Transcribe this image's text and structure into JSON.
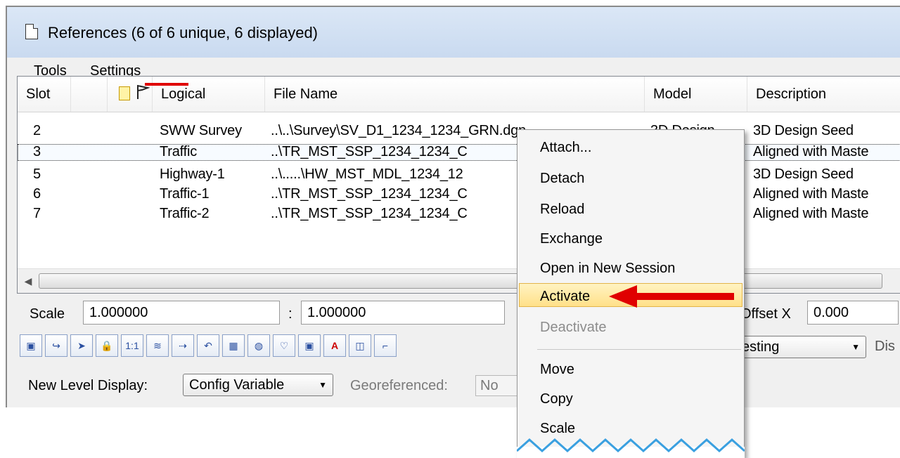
{
  "window": {
    "title": "References (6 of 6 unique, 6 displayed)"
  },
  "menubar": {
    "items": [
      {
        "label": "Tools"
      },
      {
        "label": "Settings"
      }
    ]
  },
  "columns": {
    "slot": "Slot",
    "logical": "Logical",
    "file_name": "File Name",
    "model": "Model",
    "description": "Description"
  },
  "rows": [
    {
      "slot": "2",
      "logical": "SWW Survey",
      "file": "..\\..\\Survey\\SV_D1_1234_1234_GRN.dgn",
      "model": "3D Design",
      "description": "3D Design Seed"
    },
    {
      "slot": "3",
      "logical": "Traffic",
      "file": "..\\TR_MST_SSP_1234_1234_C",
      "model": "",
      "description": "Aligned with Maste"
    },
    {
      "slot": "5",
      "logical": "Highway-1",
      "file": "..\\.....\\HW_MST_MDL_1234_12",
      "model": "",
      "description": "3D Design Seed"
    },
    {
      "slot": "6",
      "logical": "Traffic-1",
      "file": "..\\TR_MST_SSP_1234_1234_C",
      "model": "",
      "description": "Aligned with Maste"
    },
    {
      "slot": "7",
      "logical": "Traffic-2",
      "file": "..\\TR_MST_SSP_1234_1234_C",
      "model": "",
      "description": "Aligned with Maste"
    }
  ],
  "selected_row_index": 1,
  "scale": {
    "label": "Scale",
    "value1": "1.000000",
    "sep": ":",
    "value2": "1.000000"
  },
  "offset": {
    "label": "Offset X",
    "value": "0.000"
  },
  "nesting": {
    "value": "esting"
  },
  "display_label": "Dis",
  "new_level_display": {
    "label": "New Level Display:",
    "value": "Config Variable"
  },
  "georeferenced": {
    "label": "Georeferenced:",
    "value": "No"
  },
  "toolbar_buttons": [
    {
      "icon": "attach-icon",
      "text": "▣"
    },
    {
      "icon": "hook-icon",
      "text": "↪"
    },
    {
      "icon": "pointer-icon",
      "text": "➤"
    },
    {
      "icon": "lock-icon",
      "text": "🔒"
    },
    {
      "icon": "scale-1-1-icon",
      "text": "1:1"
    },
    {
      "icon": "level-icon",
      "text": "≋"
    },
    {
      "icon": "move-icon",
      "text": "⇢"
    },
    {
      "icon": "rotate-icon",
      "text": "↶"
    },
    {
      "icon": "grid-icon",
      "text": "▦"
    },
    {
      "icon": "display-icon",
      "text": "◍"
    },
    {
      "icon": "bulb-icon",
      "text": "♡"
    },
    {
      "icon": "snap-icon",
      "text": "▣"
    },
    {
      "icon": "annotate-icon",
      "text": "A"
    },
    {
      "icon": "clip-icon",
      "text": "◫"
    },
    {
      "icon": "mask-icon",
      "text": "⌐"
    }
  ],
  "context_menu": {
    "items": [
      {
        "label": "Attach...",
        "enabled": true
      },
      {
        "label": "Detach",
        "enabled": true
      },
      {
        "label": "Reload",
        "enabled": true
      },
      {
        "label": "Exchange",
        "enabled": true
      },
      {
        "label": "Open in New Session",
        "enabled": true
      },
      {
        "label": "Activate",
        "enabled": true,
        "highlighted": true
      },
      {
        "label": "Deactivate",
        "enabled": false
      },
      {
        "label": "Move",
        "enabled": true
      },
      {
        "label": "Copy",
        "enabled": true
      },
      {
        "label": "Scale",
        "enabled": true
      }
    ]
  },
  "colors": {
    "highlight": "#ffe089",
    "arrow": "#e00000",
    "zigzag": "#3aa0e0"
  }
}
